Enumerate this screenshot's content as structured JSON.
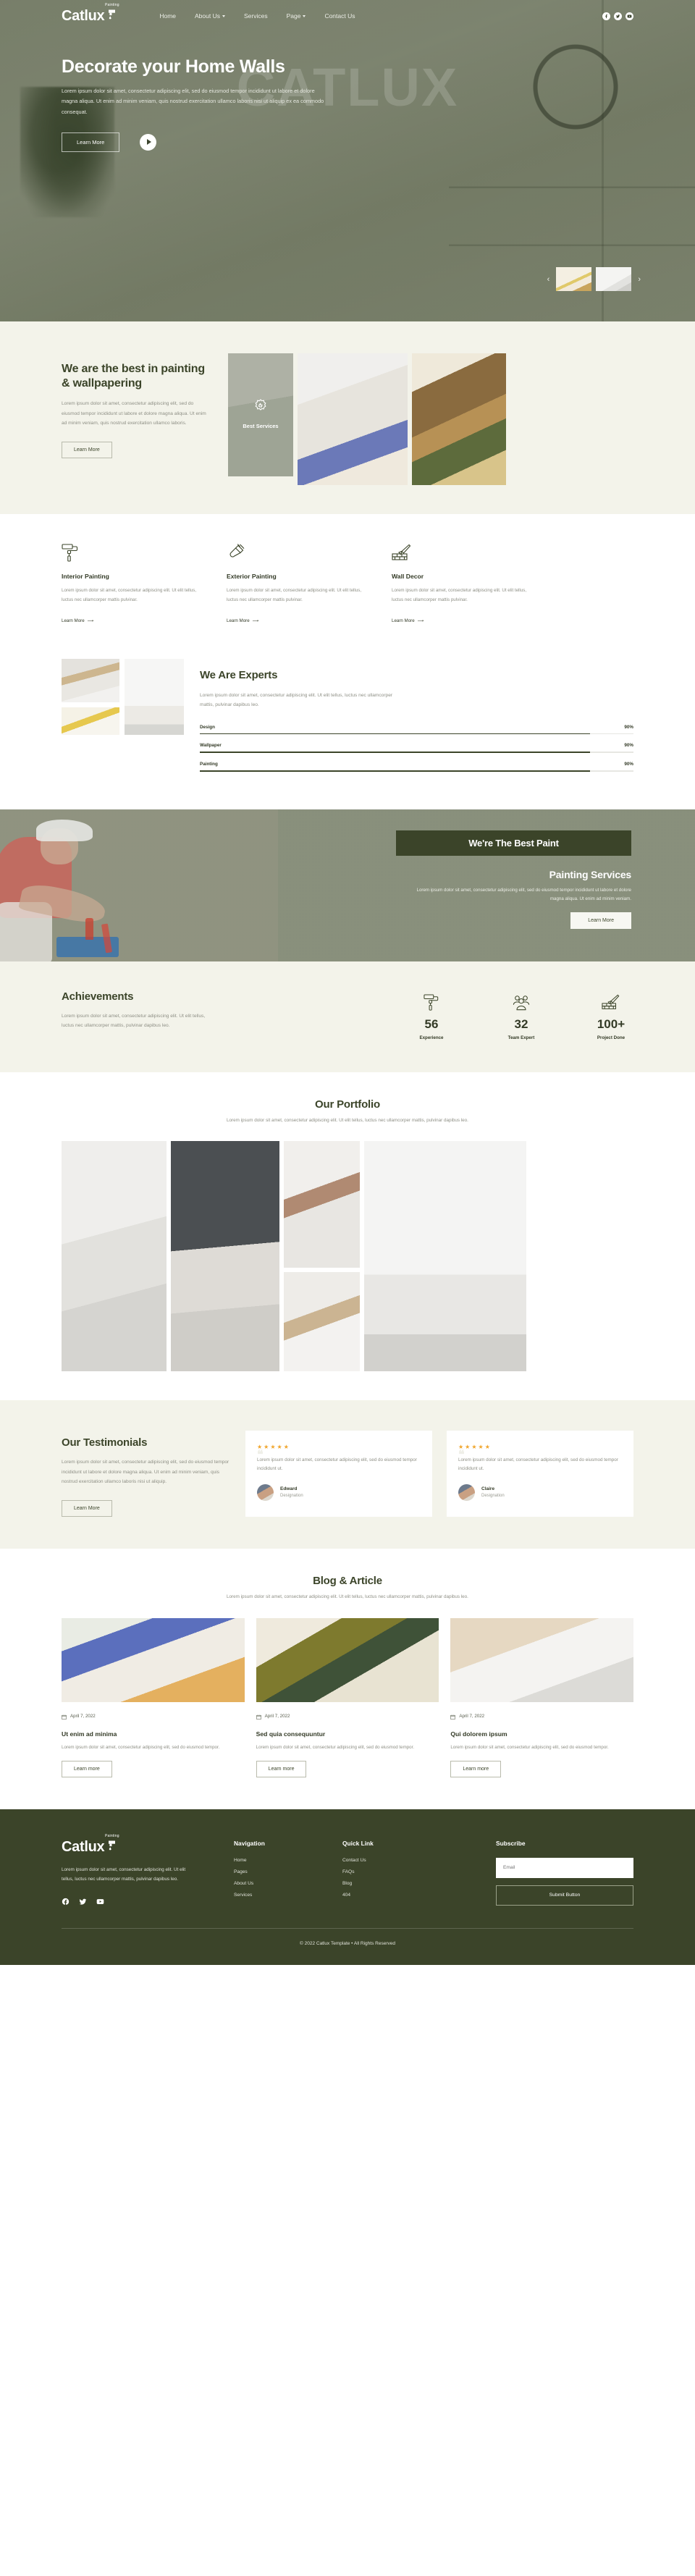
{
  "brand": {
    "name": "Catlux",
    "superscript": "Painting"
  },
  "nav": {
    "links": [
      {
        "label": "Home",
        "has_caret": false
      },
      {
        "label": "About Us",
        "has_caret": true
      },
      {
        "label": "Services",
        "has_caret": false
      },
      {
        "label": "Page",
        "has_caret": true
      },
      {
        "label": "Contact Us",
        "has_caret": false
      }
    ],
    "socials": [
      "facebook-icon",
      "twitter-icon",
      "youtube-icon"
    ]
  },
  "hero": {
    "ghost_text": "CATLUX",
    "title": "Decorate your Home Walls",
    "paragraph": "Lorem ipsum dolor sit amet, consectetur adipiscing elit, sed do eiusmod tempor incididunt ut labore et dolore magna aliqua. Ut enim ad minim veniam, quis nostrud exercitation ullamco laboris nisi ut aliquip ex ea commodo consequat.",
    "cta_label": "Learn More",
    "play_label": "play-button",
    "prev_arrow": "‹",
    "next_arrow": "›"
  },
  "best": {
    "title": "We are the best in painting & wallpapering",
    "paragraph": "Lorem ipsum dolor sit amet, consectetur adipiscing elit, sed do eiusmod tempor incididunt ut labore et dolore magna aliqua. Ut enim ad minim veniam, quis nostrud exercitation ullamco laboris.",
    "cta_label": "Learn More",
    "image_caption": "Best Services"
  },
  "services": {
    "items": [
      {
        "icon": "paint-roller-icon",
        "title": "Interior Painting",
        "text": "Lorem ipsum dolor sit amet, consectetur adipiscing elit. Ut elit tellus, luctus nec ullamcorper mattis pulvinar.",
        "link": "Learn More"
      },
      {
        "icon": "paint-brush-icon",
        "title": "Exterior Painting",
        "text": "Lorem ipsum dolor sit amet, consectetur adipiscing elit. Ut elit tellus, luctus nec ullamcorper mattis pulvinar.",
        "link": "Learn More"
      },
      {
        "icon": "brick-trowel-icon",
        "title": "Wall Decor",
        "text": "Lorem ipsum dolor sit amet, consectetur adipiscing elit. Ut elit tellus, luctus nec ullamcorper mattis pulvinar.",
        "link": "Learn More"
      }
    ]
  },
  "experts": {
    "title": "We Are Experts",
    "paragraph": "Lorem ipsum dolor sit amet, consectetur adipiscing elit. Ut elit tellus, luctus nec ullamcorper mattis, pulvinar dapibus leo.",
    "skills": [
      {
        "label": "Design",
        "percent": "90%",
        "value": 90
      },
      {
        "label": "Wallpaper",
        "percent": "90%",
        "value": 90
      },
      {
        "label": "Painting",
        "percent": "90%",
        "value": 90
      }
    ]
  },
  "paint_banner": {
    "band_title": "We're The Best Paint",
    "subtitle": "Painting Services",
    "paragraph": "Lorem ipsum dolor sit amet, consectetur adipiscing elit, sed do eiusmod tempor incididunt ut labore et dolore magna aliqua. Ut enim ad minim veniam.",
    "cta_label": "Learn More"
  },
  "achievements": {
    "title": "Achievements",
    "paragraph": "Lorem ipsum dolor sit amet, consectetur adipiscing elit. Ut elit tellus, luctus nec ullamcorper mattis, pulvinar dapibus leo.",
    "stats": [
      {
        "icon": "paint-roller-icon",
        "number": "56",
        "caption": "Experience"
      },
      {
        "icon": "team-icon",
        "number": "32",
        "caption": "Team Expert"
      },
      {
        "icon": "brick-trowel-icon",
        "number": "100+",
        "caption": "Project Done"
      }
    ]
  },
  "portfolio": {
    "title": "Our Portfolio",
    "paragraph": "Lorem ipsum dolor sit amet, consectetur adipiscing elit. Ut elit tellus, luctus nec ullamcorper mattis, pulvinar dapibus leo."
  },
  "testimonials": {
    "title": "Our Testimonials",
    "paragraph": "Lorem ipsum dolor sit amet, consectetur adipiscing elit, sed do eiusmod tempor incididunt ut labore et dolore magna aliqua. Ut enim ad minim veniam, quis nostrud exercitation ullamco laboris nisi ut aliquip.",
    "cta_label": "Learn More",
    "cards": [
      {
        "stars": "★★★★★",
        "quote_mark": "❝",
        "text": "Lorem ipsum dolor sit amet, consectetur adipiscing elit, sed do eiusmod tempor incididunt ut.",
        "name": "Edward",
        "designation": "Designation"
      },
      {
        "stars": "★★★★★",
        "quote_mark": "❝",
        "text": "Lorem ipsum dolor sit amet, consectetur adipiscing elit, sed do eiusmod tempor incididunt ut.",
        "name": "Claire",
        "designation": "Designation"
      }
    ]
  },
  "blog": {
    "title": "Blog & Article",
    "paragraph": "Lorem ipsum dolor sit amet, consectetur adipiscing elit. Ut elit tellus, luctus nec ullamcorper mattis, pulvinar dapibus leo.",
    "posts": [
      {
        "date": "April 7, 2022",
        "title": "Ut enim ad minima",
        "text": "Lorem ipsum dolor sit amet, consectetur adipiscing elit, sed do eiusmod tempor.",
        "cta": "Learn more"
      },
      {
        "date": "April 7, 2022",
        "title": "Sed quia consequuntur",
        "text": "Lorem ipsum dolor sit amet, consectetur adipiscing elit, sed do eiusmod tempor.",
        "cta": "Learn more"
      },
      {
        "date": "April 7, 2022",
        "title": "Qui dolorem ipsum",
        "text": "Lorem ipsum dolor sit amet, consectetur adipiscing elit, sed do eiusmod tempor.",
        "cta": "Learn more"
      }
    ]
  },
  "footer": {
    "about": "Lorem ipsum dolor sit amet, consectetur adipiscing elit. Ut elit tellus, luctus nec ullamcorper mattis, pulvinar dapibus leo.",
    "socials": [
      "facebook-icon",
      "twitter-icon",
      "youtube-icon"
    ],
    "navigation": {
      "heading": "Navigation",
      "links": [
        "Home",
        "Pages",
        "About Us",
        "Services"
      ]
    },
    "quicklink": {
      "heading": "Quick Link",
      "links": [
        "Contact Us",
        "FAQs",
        "Blog",
        "404"
      ]
    },
    "subscribe": {
      "heading": "Subscribe",
      "email_placeholder": "Email",
      "email_value": "",
      "submit_label": "Submit Button"
    },
    "copyright": "© 2022 Catlux Template • All Rights Reserved"
  },
  "colors": {
    "brand_dark": "#3b4429",
    "cream": "#f3f3ea",
    "hero_overlay": "#586148",
    "star": "#f0a52b",
    "muted_text": "#8e8f85"
  }
}
